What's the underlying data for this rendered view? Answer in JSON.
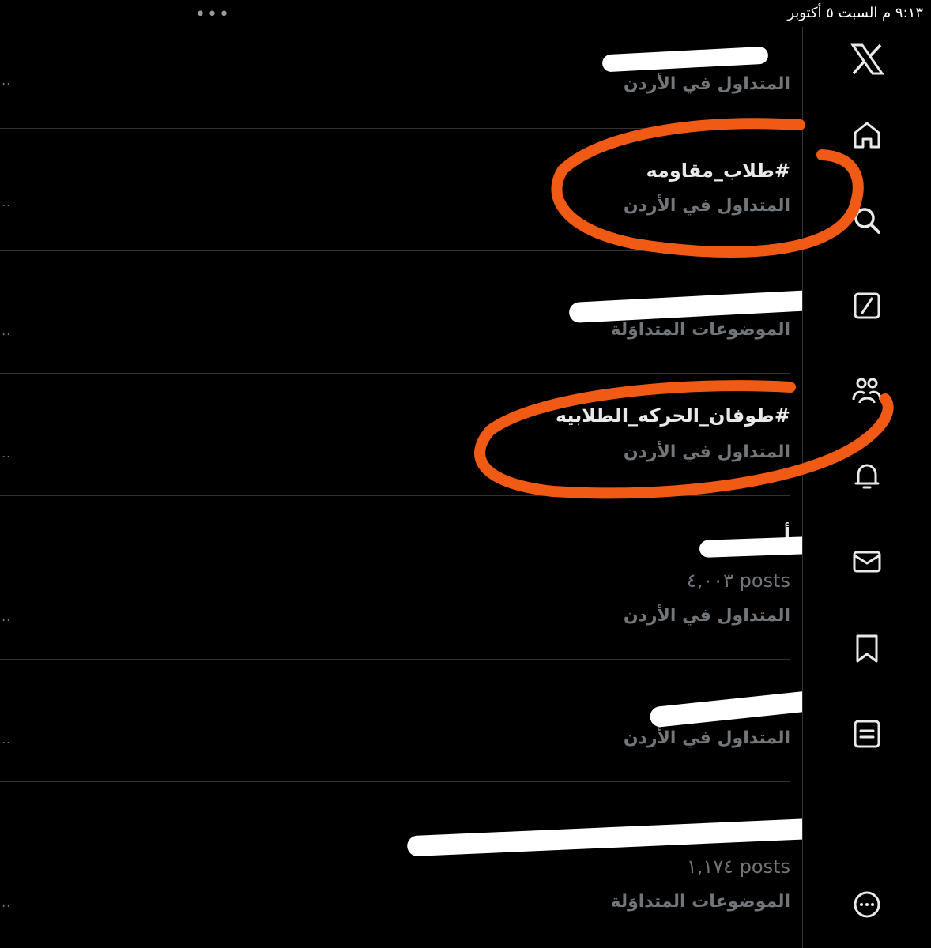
{
  "status_bar": {
    "time_date": "٩:١٣ م   السبت ٥ أكتوبر",
    "dots": "•••"
  },
  "rail": {
    "icons": [
      "x-logo-icon",
      "home-icon",
      "search-icon",
      "compose-icon",
      "communities-icon",
      "notifications-icon",
      "messages-icon",
      "bookmarks-icon",
      "lists-icon",
      "more-icon"
    ]
  },
  "trends": [
    {
      "title": "",
      "meta": "المتداول في الأردن",
      "posts": ""
    },
    {
      "title": "#طلاب_مقاومه",
      "meta": "المتداول في الأردن",
      "posts": ""
    },
    {
      "title": "",
      "meta": "الموضوعات المتداوَلة",
      "posts": ""
    },
    {
      "title": "#طوفان_الحركه_الطلابيه",
      "meta": "المتداول في الأردن",
      "posts": ""
    },
    {
      "title": "أ",
      "meta": "المتداول في الأردن",
      "posts": "٤,٠٠٣ posts"
    },
    {
      "title": "",
      "meta": "المتداول في الأردن",
      "posts": ""
    },
    {
      "title": "",
      "meta": "الموضوعات المتداوَلة",
      "posts": "١,١٧٤ posts"
    }
  ],
  "more_label": "..."
}
